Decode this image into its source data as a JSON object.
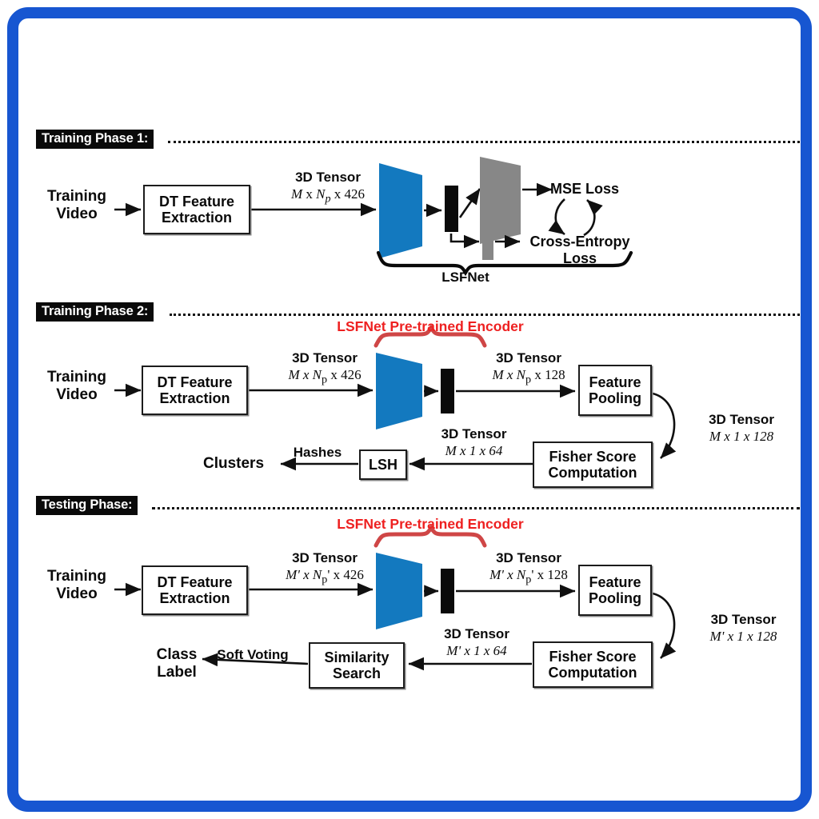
{
  "figure": {
    "title": "LSFNet three-phase pipeline diagram",
    "border_color": "#1756d1",
    "encoder_color": "#1379bf",
    "decoder_color": "#878787",
    "accent_red": "#ee2020"
  },
  "phases": [
    {
      "id": "phase1",
      "label": "Training Phase 1:"
    },
    {
      "id": "phase2",
      "label": "Training Phase 2:"
    },
    {
      "id": "phase3",
      "label": "Testing Phase:"
    }
  ],
  "phase1": {
    "input_label_line1": "Training",
    "input_label_line2": "Video",
    "dt_box_line1": "DT Feature",
    "dt_box_line2": "Extraction",
    "tensor_in_title": "3D Tensor",
    "tensor_in_dims_m": "M",
    "tensor_in_dims_rest": " x ",
    "tensor_in_dims_np": "N",
    "tensor_in_dims_np_sub": "p",
    "tensor_in_dims_tail": " x 426",
    "mse_loss": "MSE Loss",
    "ce_loss_line1": "Cross-Entropy",
    "ce_loss_line2": "Loss",
    "bracket_label": "LSFNet"
  },
  "phase2": {
    "input_label_line1": "Training",
    "input_label_line2": "Video",
    "dt_box_line1": "DT Feature",
    "dt_box_line2": "Extraction",
    "red_caption": "LSFNet Pre-trained Encoder",
    "tensor_in_title": "3D Tensor",
    "tensor_in_dims": "M x N",
    "tensor_in_sub": "p",
    "tensor_in_tail": " x 426",
    "tensor_out_title": "3D Tensor",
    "tensor_out_dims": "M x N",
    "tensor_out_sub": "p",
    "tensor_out_tail": " x 128",
    "pooling_box_line1": "Feature",
    "pooling_box_line2": "Pooling",
    "tensor_pool_title": "3D Tensor",
    "tensor_pool_dims": "M x 1 x 128",
    "fisher_box_line1": "Fisher Score",
    "fisher_box_line2": "Computation",
    "tensor_fisher_title": "3D Tensor",
    "tensor_fisher_dims": "M x 1 x 64",
    "lsh_box": "LSH",
    "hashes_label": "Hashes",
    "clusters_label": "Clusters"
  },
  "phase3": {
    "input_label_line1": "Training",
    "input_label_line2": "Video",
    "dt_box_line1": "DT Feature",
    "dt_box_line2": "Extraction",
    "red_caption": "LSFNet Pre-trained Encoder",
    "tensor_in_title": "3D Tensor",
    "tensor_in_dims": "M' x N",
    "tensor_in_sub": "p",
    "tensor_in_tail": "' x 426",
    "tensor_out_title": "3D Tensor",
    "tensor_out_dims": "M' x N",
    "tensor_out_sub": "p",
    "tensor_out_tail": "' x 128",
    "pooling_box_line1": "Feature",
    "pooling_box_line2": "Pooling",
    "tensor_pool_title": "3D Tensor",
    "tensor_pool_dims": "M' x 1 x 128",
    "fisher_box_line1": "Fisher Score",
    "fisher_box_line2": "Computation",
    "tensor_fisher_title": "3D Tensor",
    "tensor_fisher_dims": "M' x 1 x 64",
    "similarity_box_line1": "Similarity",
    "similarity_box_line2": "Search",
    "soft_voting_label": "Soft Voting",
    "class_label_line1": "Class",
    "class_label_line2": "Label"
  }
}
